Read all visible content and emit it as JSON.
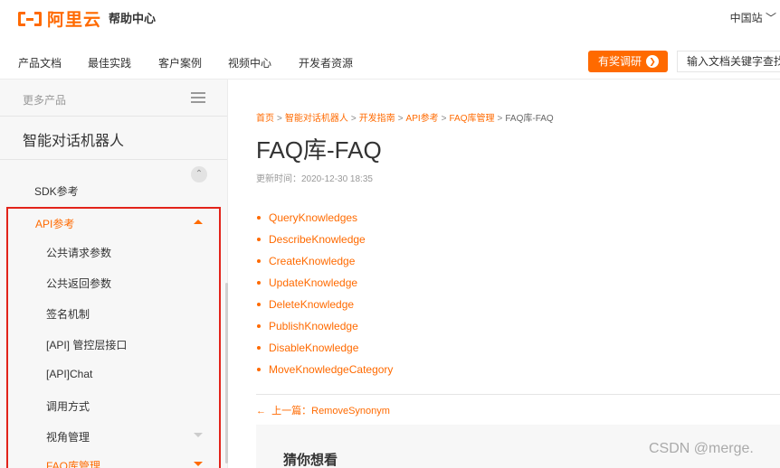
{
  "header": {
    "logo_text": "阿里云",
    "help_center": "帮助中心",
    "region": "中国站"
  },
  "nav": {
    "items": [
      "产品文档",
      "最佳实践",
      "客户案例",
      "视频中心",
      "开发者资源"
    ],
    "reward_button": "有奖调研",
    "search_placeholder": "输入文档关键字查找"
  },
  "sidebar": {
    "more_products": "更多产品",
    "product_title": "智能对话机器人",
    "sdk_item": "SDK参考",
    "api_section": {
      "label": "API参考",
      "items": [
        {
          "label": "公共请求参数"
        },
        {
          "label": "公共返回参数"
        },
        {
          "label": "签名机制"
        },
        {
          "label": "[API] 管控层接口"
        },
        {
          "label": "[API]Chat"
        },
        {
          "label": "调用方式"
        },
        {
          "label": "视角管理"
        },
        {
          "label": "FAQ库管理"
        }
      ]
    }
  },
  "main": {
    "breadcrumb": [
      "首页",
      "智能对话机器人",
      "开发指南",
      "API参考",
      "FAQ库管理",
      "FAQ库-FAQ"
    ],
    "title": "FAQ库-FAQ",
    "update_time": "更新时间：2020-12-30 18:35",
    "api_links": [
      "QueryKnowledges",
      "DescribeKnowledge",
      "CreateKnowledge",
      "UpdateKnowledge",
      "DeleteKnowledge",
      "PublishKnowledge",
      "DisableKnowledge",
      "MoveKnowledgeCategory"
    ],
    "prev_link": "上一篇：RemoveSynonym",
    "guess_title": "猜你想看"
  },
  "watermark": "CSDN @merge.",
  "colors": {
    "accent": "#ff6a00",
    "highlight_border": "#e2231a"
  }
}
